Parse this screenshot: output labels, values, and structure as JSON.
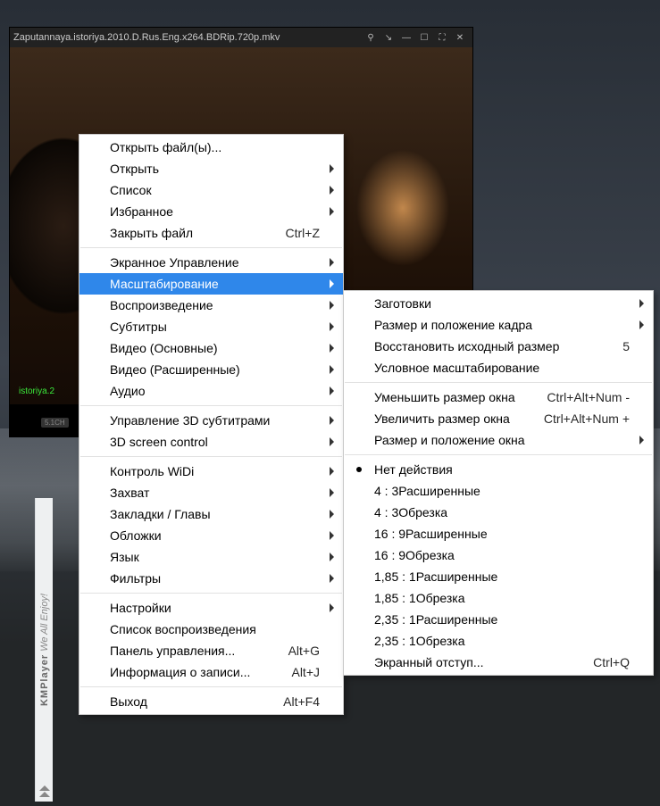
{
  "player": {
    "title": "Zaputannaya.istoriya.2010.D.Rus.Eng.x264.BDRip.720p.mkv",
    "overlay_filename": "istoriya.2",
    "audio_badge": "5.1CH"
  },
  "kmstrip": {
    "brand": "KMPlayer",
    "tagline": "We All Enjoy!"
  },
  "ctx": {
    "groups": [
      [
        {
          "label": "Открыть файл(ы)..."
        },
        {
          "label": "Открыть",
          "submenu": true
        },
        {
          "label": "Список",
          "submenu": true
        },
        {
          "label": "Избранное",
          "submenu": true
        },
        {
          "label": "Закрыть файл",
          "shortcut": "Ctrl+Z"
        }
      ],
      [
        {
          "label": "Экранное Управление",
          "submenu": true
        },
        {
          "label": "Масштабирование",
          "submenu": true,
          "selected": true
        },
        {
          "label": "Воспроизведение",
          "submenu": true
        },
        {
          "label": "Субтитры",
          "submenu": true
        },
        {
          "label": "Видео (Основные)",
          "submenu": true
        },
        {
          "label": "Видео (Расширенные)",
          "submenu": true
        },
        {
          "label": "Аудио",
          "submenu": true
        }
      ],
      [
        {
          "label": "Управление 3D субтитрами",
          "submenu": true
        },
        {
          "label": "3D screen control",
          "submenu": true
        }
      ],
      [
        {
          "label": "Контроль WiDi",
          "submenu": true
        },
        {
          "label": "Захват",
          "submenu": true
        },
        {
          "label": "Закладки / Главы",
          "submenu": true
        },
        {
          "label": "Обложки",
          "submenu": true
        },
        {
          "label": "Язык",
          "submenu": true
        },
        {
          "label": "Фильтры",
          "submenu": true
        }
      ],
      [
        {
          "label": "Настройки",
          "submenu": true
        },
        {
          "label": "Список воспроизведения"
        },
        {
          "label": "Панель управления...",
          "shortcut": "Alt+G"
        },
        {
          "label": "Информация о записи...",
          "shortcut": "Alt+J"
        }
      ],
      [
        {
          "label": "Выход",
          "shortcut": "Alt+F4"
        }
      ]
    ]
  },
  "sub": {
    "groups": [
      [
        {
          "label": "Заготовки",
          "submenu": true
        },
        {
          "label": "Размер и положение кадра",
          "submenu": true
        },
        {
          "label": "Восстановить исходный размер",
          "shortcut": "5"
        },
        {
          "label": "Условное масштабирование"
        }
      ],
      [
        {
          "label": "Уменьшить размер окна",
          "shortcut": "Ctrl+Alt+Num -"
        },
        {
          "label": "Увеличить размер окна",
          "shortcut": "Ctrl+Alt+Num +"
        },
        {
          "label": "Размер и положение окна",
          "submenu": true
        }
      ],
      [
        {
          "label": "Нет действия",
          "radio": true
        },
        {
          "label": "4 : 3Расширенные"
        },
        {
          "label": "4 : 3Обрезка"
        },
        {
          "label": "16 : 9Расширенные"
        },
        {
          "label": "16 : 9Обрезка"
        },
        {
          "label": "1,85 : 1Расширенные"
        },
        {
          "label": "1,85 : 1Обрезка"
        },
        {
          "label": "2,35 : 1Расширенные"
        },
        {
          "label": "2,35 : 1Обрезка"
        },
        {
          "label": "Экранный отступ...",
          "shortcut": "Ctrl+Q"
        }
      ]
    ]
  }
}
